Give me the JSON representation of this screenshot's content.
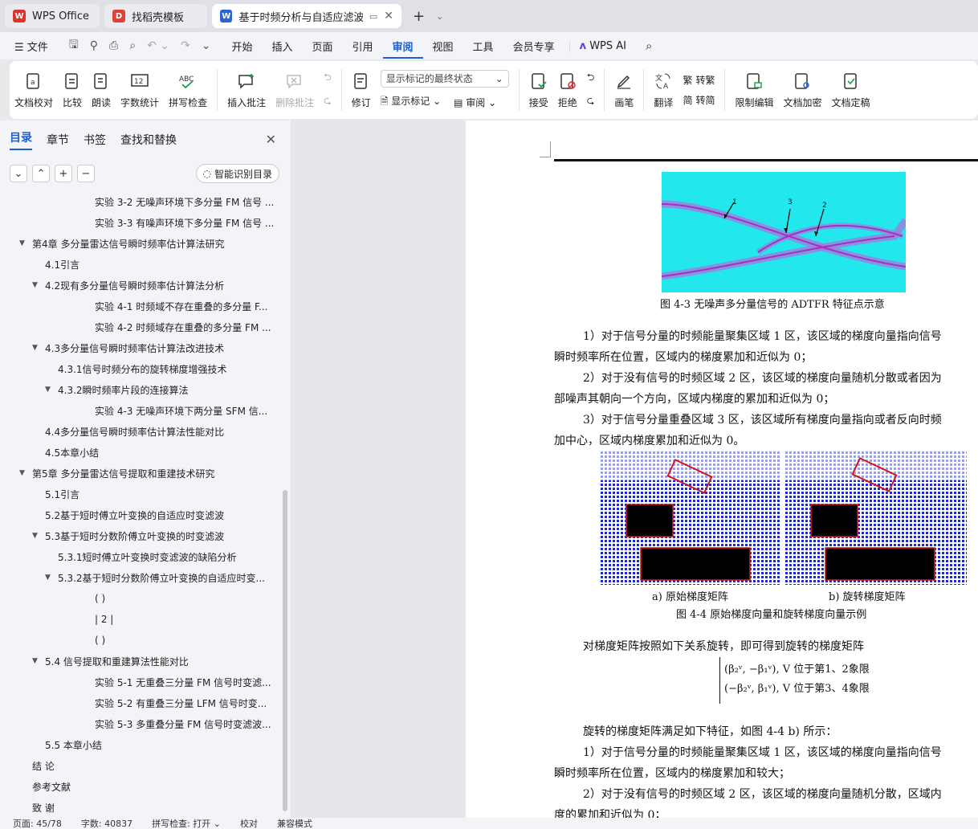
{
  "tabs": [
    {
      "label": "WPS Office",
      "color": "#d9342b"
    },
    {
      "label": "找稻壳模板",
      "color": "#e0403a"
    },
    {
      "label": "基于时频分析与自适应滤波技",
      "color": "#2a63d8"
    }
  ],
  "menu": {
    "file": "文件",
    "items": [
      "开始",
      "插入",
      "页面",
      "引用",
      "审阅",
      "视图",
      "工具",
      "会员专享"
    ],
    "active": "审阅",
    "ai": "WPS AI"
  },
  "ribbon": {
    "proof": "文档校对",
    "compare": "比较",
    "read": "朗读",
    "count": "字数统计",
    "spell": "拼写检查",
    "insert_comment": "插入批注",
    "delete_comment": "删除批注",
    "revise": "修订",
    "markup_select": "显示标记的最终状态",
    "show_markup": "显示标记",
    "review": "审阅",
    "accept": "接受",
    "reject": "拒绝",
    "pen": "画笔",
    "translate": "翻译",
    "to_trad": "转繁",
    "to_simp": "转简",
    "restrict": "限制编辑",
    "encrypt": "文档加密",
    "finalize": "文档定稿"
  },
  "sidebar": {
    "tabs": [
      "目录",
      "章节",
      "书签",
      "查找和替换"
    ],
    "smart": "智能识别目录",
    "items": [
      {
        "t": "实验 3-2 无噪声环境下多分量 FM 信号 ...",
        "lvl": 4,
        "arr": ""
      },
      {
        "t": "实验 3-3 有噪声环境下多分量 FM 信号 ...",
        "lvl": 4,
        "arr": ""
      },
      {
        "t": "第4章 多分量雷达信号瞬时频率估计算法研究",
        "lvl": 1,
        "arr": "▼"
      },
      {
        "t": "4.1引言",
        "lvl": 2,
        "arr": ""
      },
      {
        "t": "4.2现有多分量信号瞬时频率估计算法分析",
        "lvl": 2,
        "arr": "▼"
      },
      {
        "t": "实验 4-1 时频域不存在重叠的多分量 F...",
        "lvl": 4,
        "arr": ""
      },
      {
        "t": "实验 4-2 时频域存在重叠的多分量 FM ...",
        "lvl": 4,
        "arr": ""
      },
      {
        "t": "4.3多分量信号瞬时频率估计算法改进技术",
        "lvl": 2,
        "arr": "▼"
      },
      {
        "t": "4.3.1信号时频分布的旋转梯度增强技术",
        "lvl": 3,
        "arr": ""
      },
      {
        "t": "4.3.2瞬时频率片段的连接算法",
        "lvl": 3,
        "arr": "▼"
      },
      {
        "t": "实验 4-3 无噪声环境下两分量 SFM 信...",
        "lvl": 4,
        "arr": ""
      },
      {
        "t": "4.4多分量信号瞬时频率估计算法性能对比",
        "lvl": 2,
        "arr": ""
      },
      {
        "t": "4.5本章小结",
        "lvl": 2,
        "arr": ""
      },
      {
        "t": "第5章 多分量雷达信号提取和重建技术研究",
        "lvl": 1,
        "arr": "▼"
      },
      {
        "t": "5.1引言",
        "lvl": 2,
        "arr": ""
      },
      {
        "t": "5.2基于短时傅立叶变换的自适应时变滤波",
        "lvl": 2,
        "arr": ""
      },
      {
        "t": "5.3基于短时分数阶傅立叶变换的时变滤波",
        "lvl": 2,
        "arr": "▼"
      },
      {
        "t": "5.3.1短时傅立叶变换时变滤波的缺陷分析",
        "lvl": 3,
        "arr": ""
      },
      {
        "t": "5.3.2基于短时分数阶傅立叶变换的自适应时变...",
        "lvl": 3,
        "arr": "▼"
      },
      {
        "t": "( )",
        "lvl": 4,
        "arr": ""
      },
      {
        "t": "| 2 |",
        "lvl": 4,
        "arr": ""
      },
      {
        "t": "( )",
        "lvl": 4,
        "arr": ""
      },
      {
        "t": "5.4 信号提取和重建算法性能对比",
        "lvl": 2,
        "arr": "▼"
      },
      {
        "t": "实验 5-1 无重叠三分量 FM 信号时变滤...",
        "lvl": 4,
        "arr": ""
      },
      {
        "t": "实验 5-2 有重叠三分量 LFM 信号时变...",
        "lvl": 4,
        "arr": ""
      },
      {
        "t": "实验 5-3 多重叠分量 FM 信号时变滤波...",
        "lvl": 4,
        "arr": ""
      },
      {
        "t": "5.5 本章小结",
        "lvl": 2,
        "arr": ""
      },
      {
        "t": "结  论",
        "lvl": 1,
        "arr": ""
      },
      {
        "t": "参考文献",
        "lvl": 1,
        "arr": ""
      },
      {
        "t": "致  谢",
        "lvl": 1,
        "arr": ""
      }
    ]
  },
  "doc": {
    "fig43_labels": [
      "1",
      "3",
      "2"
    ],
    "fig43_caption": "图 4-3 无噪声多分量信号的 ADTFR 特征点示意",
    "p1a": "1）对于信号分量的时频能量聚集区域 1 区，该区域的梯度向量指向信号",
    "p1b": "瞬时频率所在位置，区域内的梯度累加和近似为 0；",
    "p2a": "2）对于没有信号的时频区域 2 区，该区域的梯度向量随机分散或者因为",
    "p2b": "部噪声其朝向一个方向，区域内梯度的累加和近似为 0；",
    "p3a": "3）对于信号分量重叠区域 3 区，该区域所有梯度向量指向或者反向时频",
    "p3b": "加中心，区域内梯度累加和近似为 0。",
    "sub_a": "a) 原始梯度矩阵",
    "sub_b": "b) 旋转梯度矩阵",
    "fig44_caption": "图 4-4 原始梯度向量和旋转梯度向量示例",
    "p4": "对梯度矩阵按照如下关系旋转，即可得到旋转的梯度矩阵",
    "eq1": "(β₂ᵛ, −β₁ᵛ), V 位于第1、2象限",
    "eq2": "(−β₂ᵛ, β₁ᵛ), V 位于第3、4象限",
    "p5": "旋转的梯度矩阵满足如下特征，如图 4-4 b) 所示：",
    "p6a": "1）对于信号分量的时频能量聚集区域 1 区，该区域的梯度向量指向信号",
    "p6b": "瞬时频率所在位置，区域内的梯度累加和较大；",
    "p7a": "2）对于没有信号的时频区域 2 区，该区域的梯度向量随机分散，区域内",
    "p7b": "度的累加和近似为 0；"
  },
  "status": {
    "page": "页面: 45/78",
    "words": "字数: 40837",
    "spell": "拼写检查: 打开",
    "proof": "校对",
    "compat": "兼容模式"
  }
}
